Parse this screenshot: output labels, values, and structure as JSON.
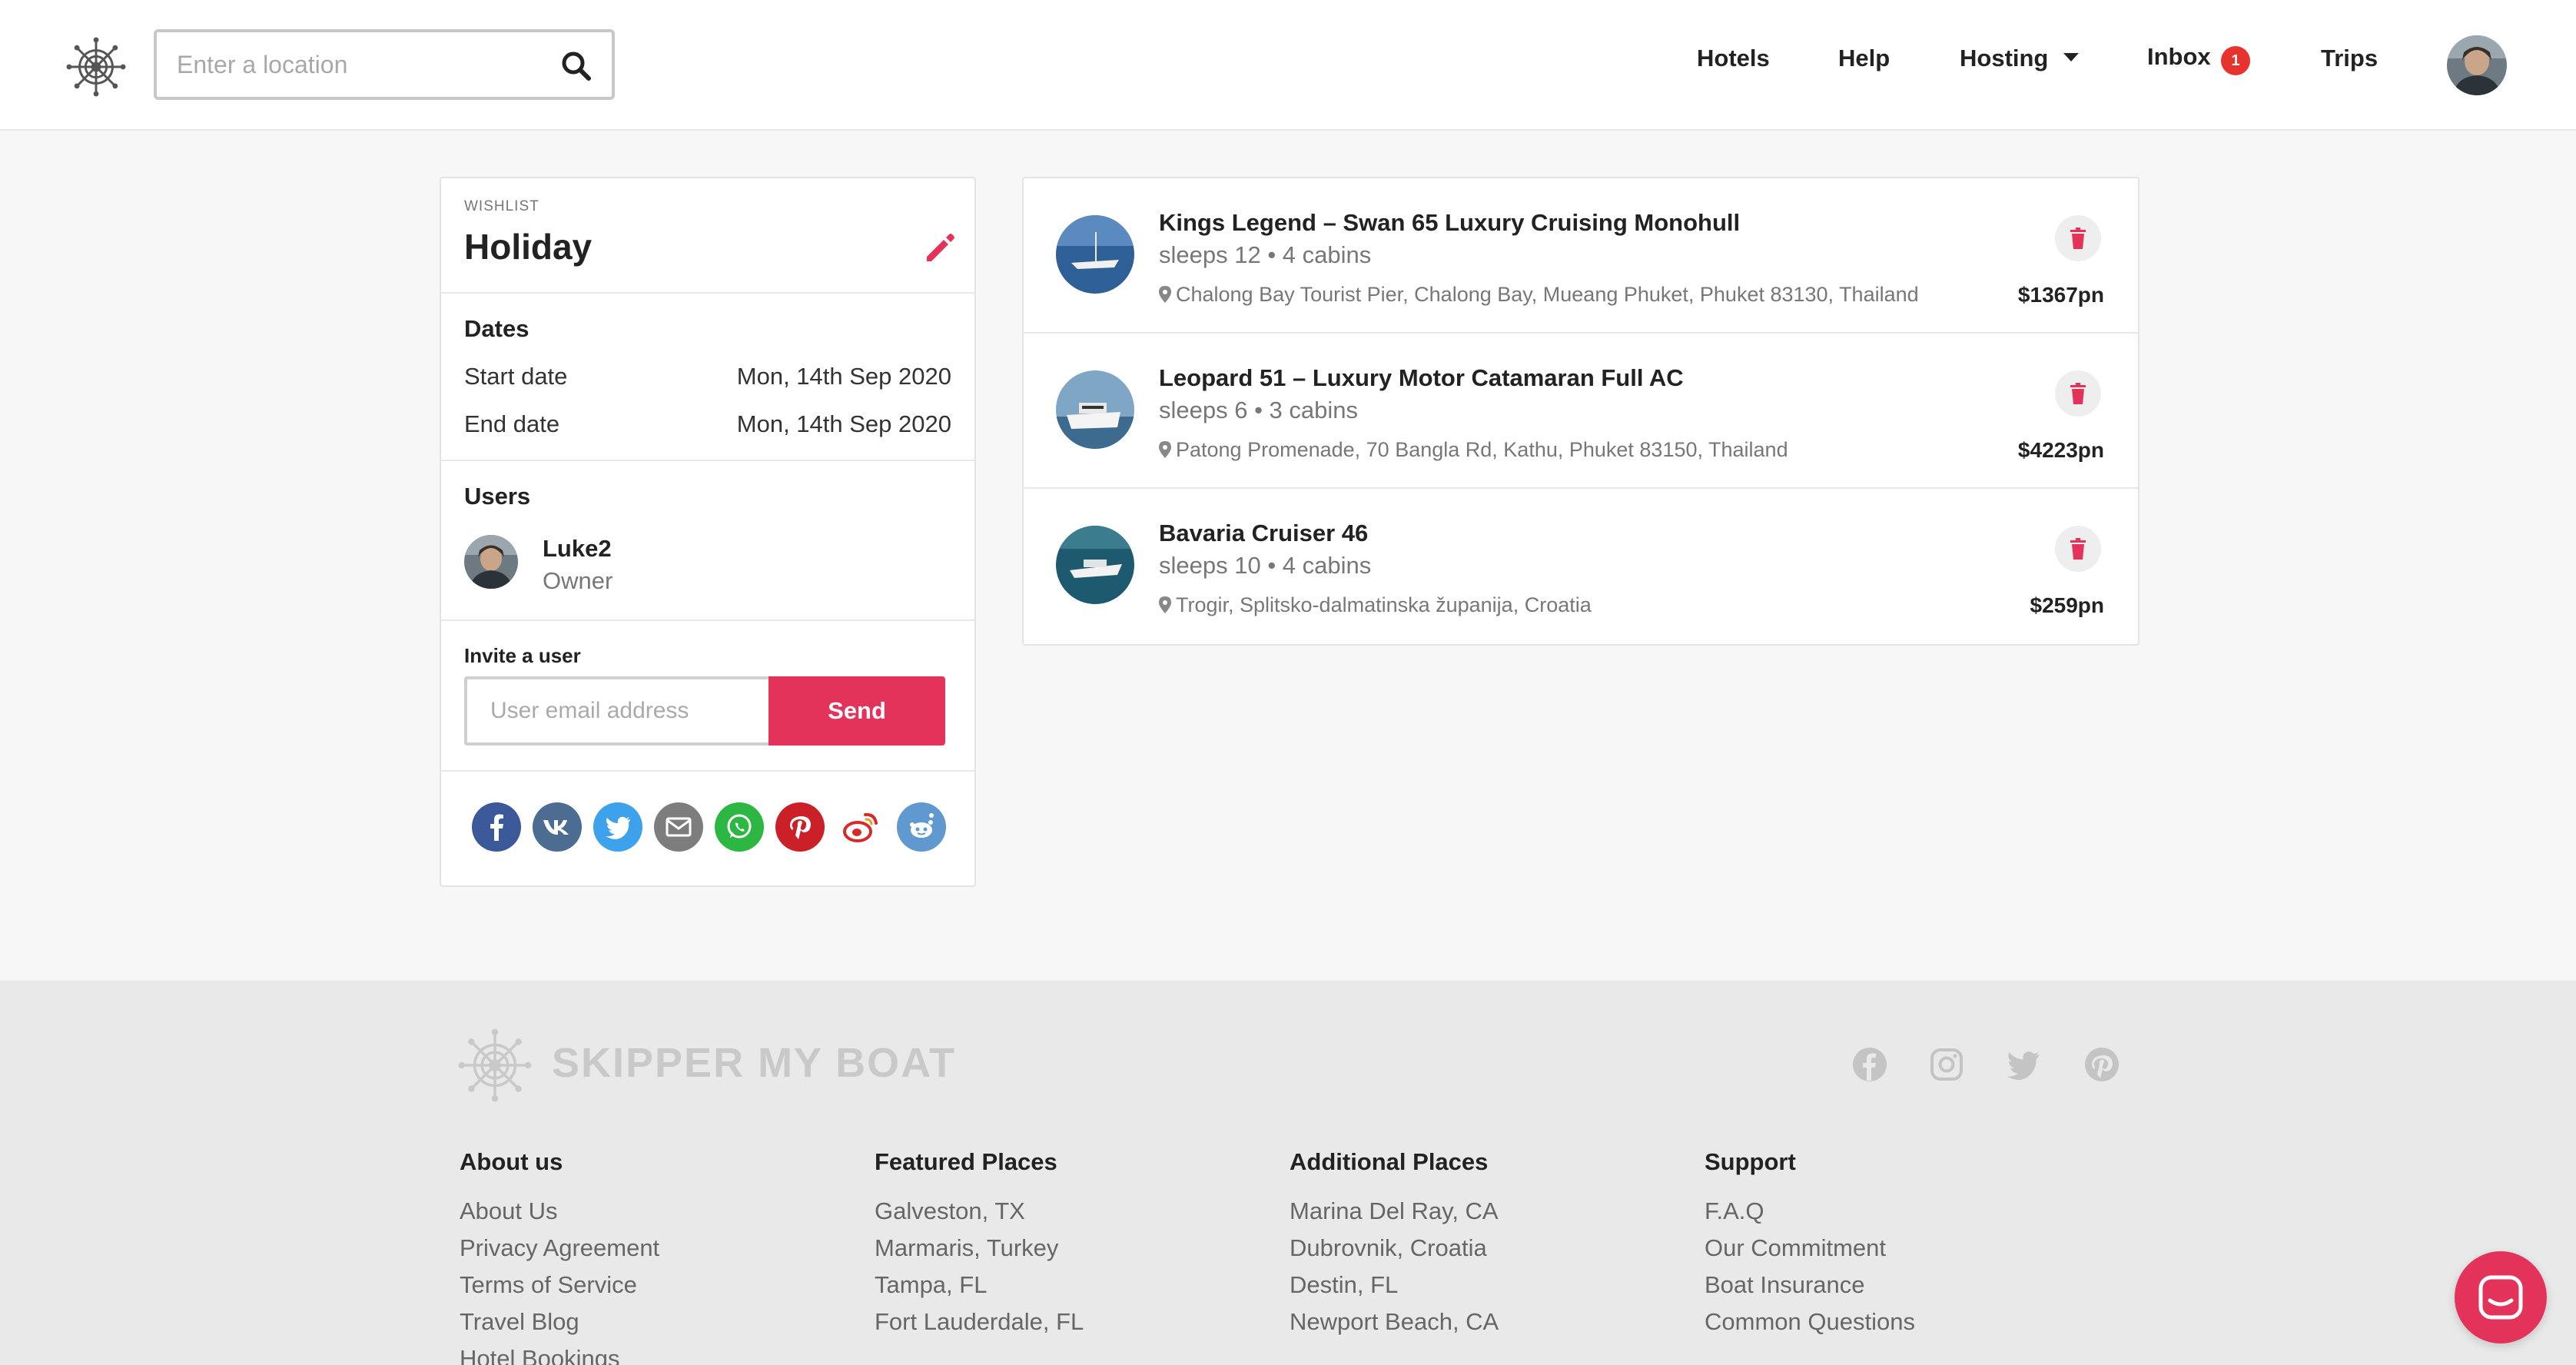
{
  "header": {
    "search_placeholder": "Enter a location",
    "nav": {
      "hotels": "Hotels",
      "help": "Help",
      "hosting": "Hosting",
      "inbox": "Inbox",
      "inbox_badge": "1",
      "trips": "Trips"
    }
  },
  "wishlist": {
    "label": "WISHLIST",
    "title": "Holiday",
    "dates_heading": "Dates",
    "start_label": "Start date",
    "start_value": "Mon, 14th Sep 2020",
    "end_label": "End date",
    "end_value": "Mon, 14th Sep 2020",
    "users_heading": "Users",
    "user": {
      "name": "Luke2",
      "role": "Owner"
    },
    "invite_label": "Invite a user",
    "invite_placeholder": "User email address",
    "send_label": "Send",
    "share_icons": [
      "facebook-icon",
      "vk-icon",
      "twitter-icon",
      "email-icon",
      "whatsapp-icon",
      "pinterest-icon",
      "weibo-icon",
      "reddit-icon"
    ]
  },
  "listings": [
    {
      "title": "Kings Legend – Swan 65 Luxury Cruising Monohull",
      "sleeps": "sleeps 12 • 4 cabins",
      "location": "Chalong Bay Tourist Pier, Chalong Bay, Mueang Phuket, Phuket 83130, Thailand",
      "price": "$1367pn"
    },
    {
      "title": "Leopard 51 – Luxury Motor Catamaran Full AC",
      "sleeps": "sleeps 6 • 3 cabins",
      "location": "Patong Promenade, 70 Bangla Rd, Kathu, Phuket 83150, Thailand",
      "price": "$4223pn"
    },
    {
      "title": "Bavaria Cruiser 46",
      "sleeps": "sleeps 10 • 4 cabins",
      "location": "Trogir, Splitsko-dalmatinska županija, Croatia",
      "price": "$259pn"
    }
  ],
  "footer": {
    "brand": "SKIPPER MY BOAT",
    "social_icons": [
      "facebook-icon",
      "instagram-icon",
      "twitter-icon",
      "pinterest-icon"
    ],
    "columns": [
      {
        "heading": "About us",
        "links": [
          "About Us",
          "Privacy Agreement",
          "Terms of Service",
          "Travel Blog",
          "Hotel Bookings"
        ]
      },
      {
        "heading": "Featured Places",
        "links": [
          "Galveston, TX",
          "Marmaris, Turkey",
          "Tampa, FL",
          "Fort Lauderdale, FL"
        ]
      },
      {
        "heading": "Additional Places",
        "links": [
          "Marina Del Ray, CA",
          "Dubrovnik, Croatia",
          "Destin, FL",
          "Newport Beach, CA"
        ]
      },
      {
        "heading": "Support",
        "links": [
          "F.A.Q",
          "Our Commitment",
          "Boat Insurance",
          "Common Questions"
        ]
      }
    ]
  },
  "colors": {
    "accent": "#e4335a",
    "badge": "#e8322d",
    "text": "#222222",
    "muted": "#777777",
    "footer_bg": "#e9e9e9"
  }
}
